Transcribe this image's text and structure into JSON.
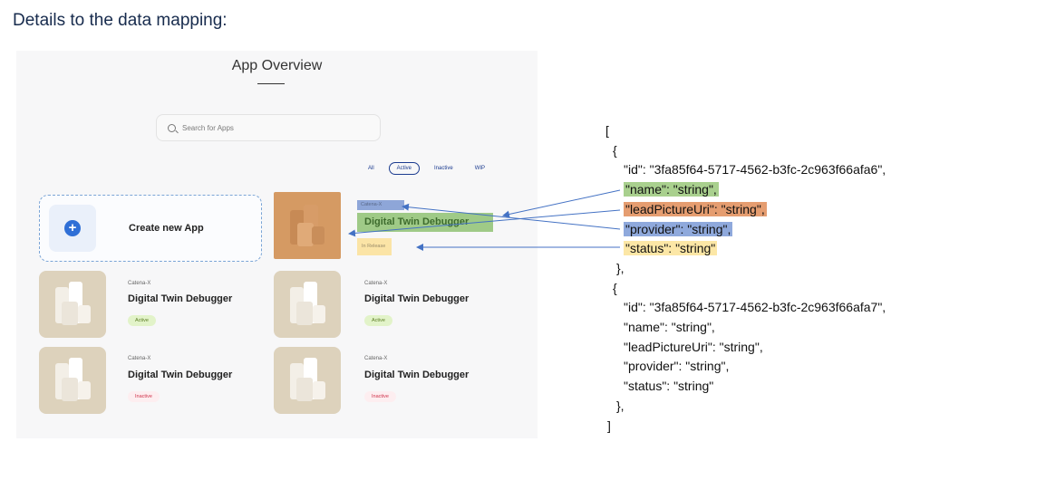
{
  "heading": "Details to the data mapping:",
  "mockup": {
    "title": "App Overview",
    "search_placeholder": "Search for Apps",
    "filters": [
      "All",
      "Active",
      "Inactive",
      "WIP"
    ],
    "active_filter": "Active",
    "create_label": "Create new App",
    "highlighted_card": {
      "provider": "Catena-X",
      "name": "Digital Twin Debugger",
      "status": "In Release"
    },
    "cards": [
      {
        "provider": "Catena-X",
        "name": "Digital Twin Debugger",
        "status": "Active",
        "status_type": "active"
      },
      {
        "provider": "Catena-X",
        "name": "Digital Twin Debugger",
        "status": "Active",
        "status_type": "active"
      },
      {
        "provider": "Catena-X",
        "name": "Digital Twin Debugger",
        "status": "Inactive",
        "status_type": "inactive"
      },
      {
        "provider": "Catena-X",
        "name": "Digital Twin Debugger",
        "status": "Inactive",
        "status_type": "inactive"
      }
    ],
    "colors": {
      "accent": "#2f6fd6",
      "arrow": "#4472c4",
      "active_bg": "#e2f3c9",
      "inactive_text": "#d0334b"
    }
  },
  "json_sample": {
    "open_bracket": "[",
    "close_bracket": "]",
    "obj_open": "{",
    "obj_close": "},",
    "objects": [
      {
        "id_line": "\"id\": \"3fa85f64-5717-4562-b3fc-2c963f66afa6\",",
        "name_line": "\"name\": \"string\",",
        "lead_line": "\"leadPictureUri\": \"string\",",
        "provider_line": "\"provider\": \"string\",",
        "status_line": "\"status\": \"string\""
      },
      {
        "id_line": "\"id\": \"3fa85f64-5717-4562-b3fc-2c963f66afa7\",",
        "name_line": "\"name\": \"string\",",
        "lead_line": "\"leadPictureUri\": \"string\",",
        "provider_line": "\"provider\": \"string\",",
        "status_line": "\"status\": \"string\""
      }
    ]
  }
}
